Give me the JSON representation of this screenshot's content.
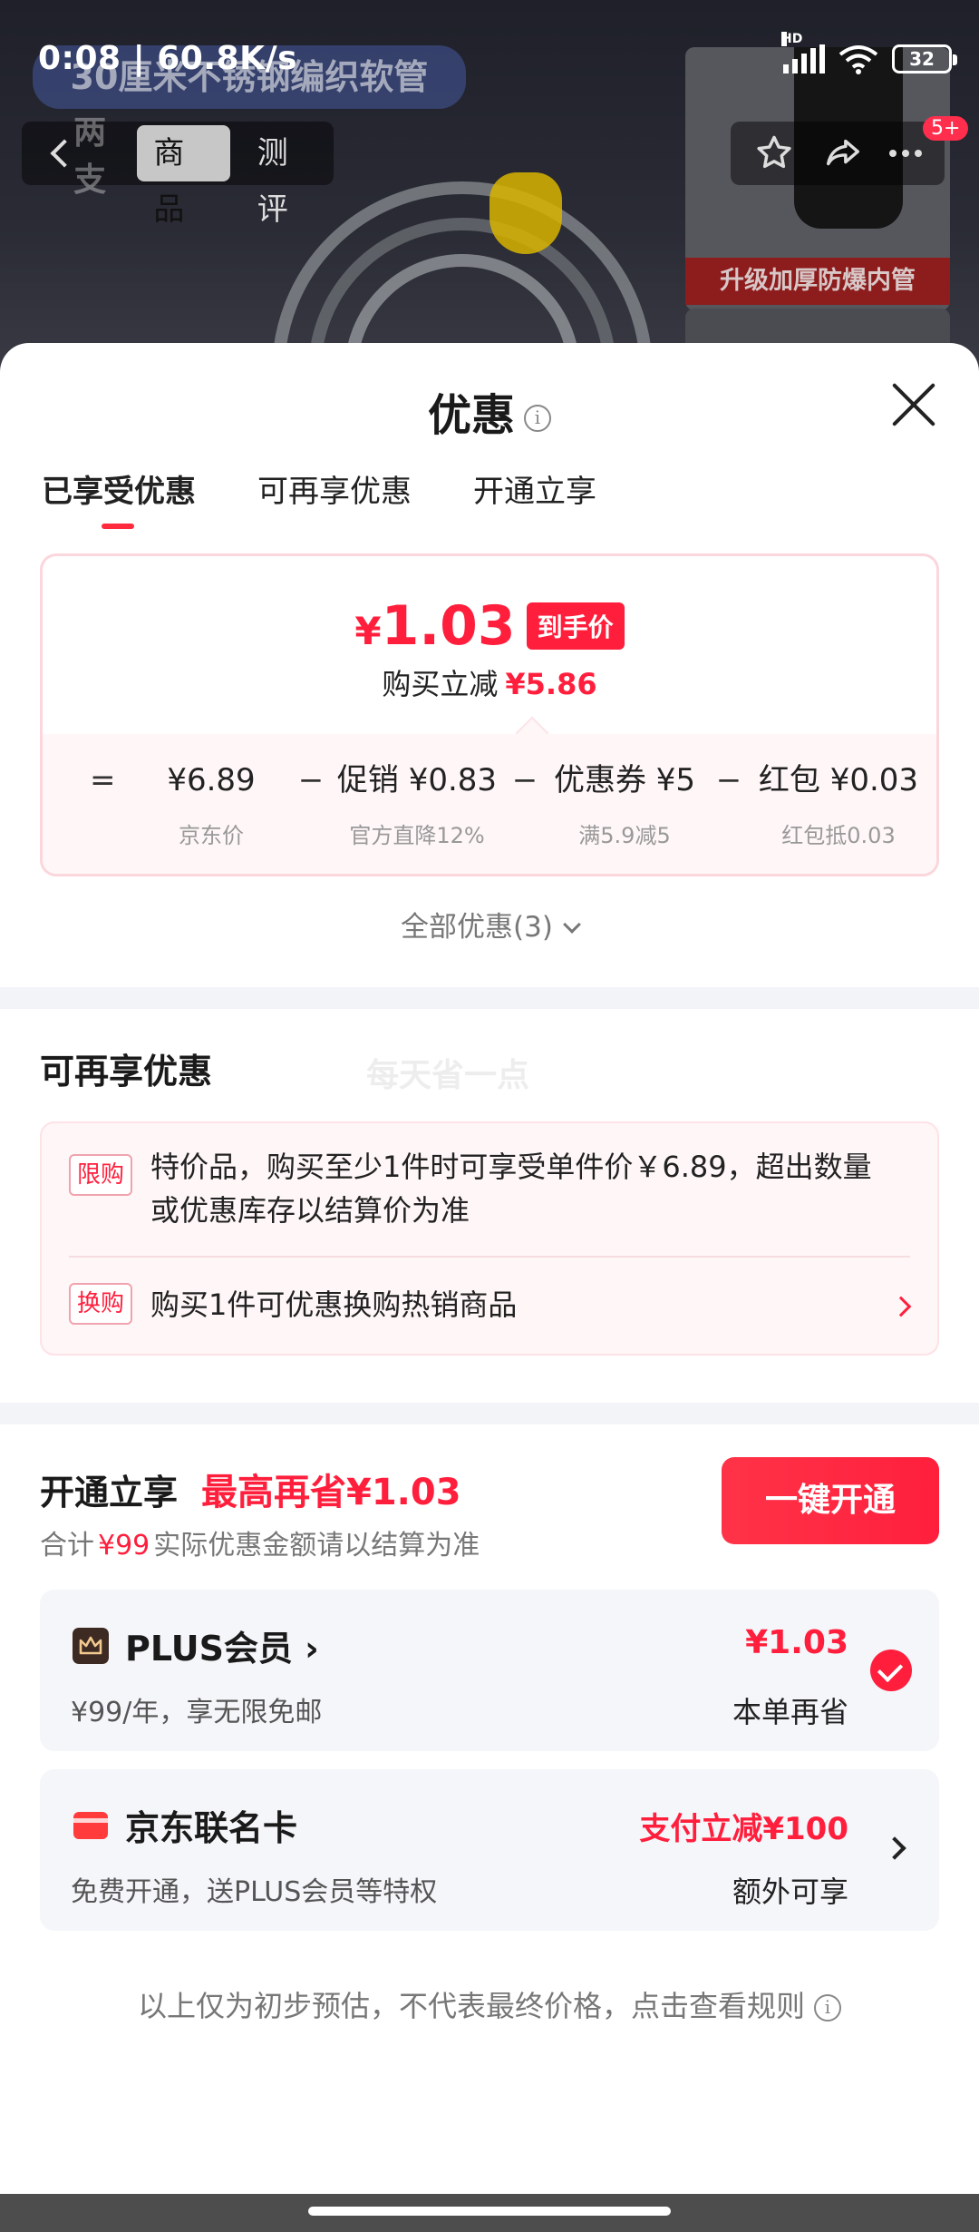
{
  "status_bar": {
    "time_speed": "0:08 | 60.8K/s",
    "signal_tag": "HD",
    "battery": "32"
  },
  "background": {
    "product_title": "30厘米不锈钢编织软管",
    "thumbnail_banner": "升级加厚防爆内管",
    "nav_ghost_text": "两支",
    "tabs": [
      "商品",
      "测评"
    ],
    "active_tab": "商品",
    "message_badge": "5+"
  },
  "sheet": {
    "title": "优惠",
    "tabs": [
      "已享受优惠",
      "可再享优惠",
      "开通立享"
    ],
    "price_card": {
      "currency": "¥",
      "final_price": "1.03",
      "final_tag": "到手价",
      "reduce_label": "购买立减",
      "reduce_value": "¥5.86",
      "formula": [
        {
          "op": "=",
          "value": "¥6.89",
          "sub": "京东价"
        },
        {
          "op": "−",
          "value": "促销 ¥0.83",
          "sub": "官方直降12%"
        },
        {
          "op": "−",
          "value": "优惠券 ¥5",
          "sub": "满5.9减5"
        },
        {
          "op": "−",
          "value": "红包 ¥0.03",
          "sub": "红包抵0.03"
        }
      ]
    },
    "all_promos": "全部优惠(3)",
    "more_section": {
      "title": "可再享优惠",
      "watermark": "每天省一点",
      "items": [
        {
          "label": "限购",
          "text": "特价品，购买至少1件时可享受单件价￥6.89，超出数量或优惠库存以结算价为准"
        },
        {
          "label": "换购",
          "text": "购买1件可优惠换购热销商品"
        }
      ]
    },
    "open_section": {
      "title": "开通立享",
      "max_save": "最高再省¥1.03",
      "total_label": "合计",
      "total_value": "¥99",
      "total_note": "实际优惠金额请以结算为准",
      "open_button": "一键开通",
      "plus": {
        "title": "PLUS会员 ›",
        "sub": "¥99/年，享无限免邮",
        "right_top": "¥1.03",
        "right_bottom": "本单再省"
      },
      "card": {
        "title": "京东联名卡",
        "sub": "免费开通，送PLUS会员等特权",
        "right_top": "支付立减¥100",
        "right_bottom": "额外可享"
      }
    },
    "footer_note": "以上仅为初步预估，不代表最终价格，点击查看规则"
  },
  "colors": {
    "accent": "#ff1f3d",
    "plus_icon": "#3d2a22",
    "card_icon": "#ff3b3b"
  }
}
